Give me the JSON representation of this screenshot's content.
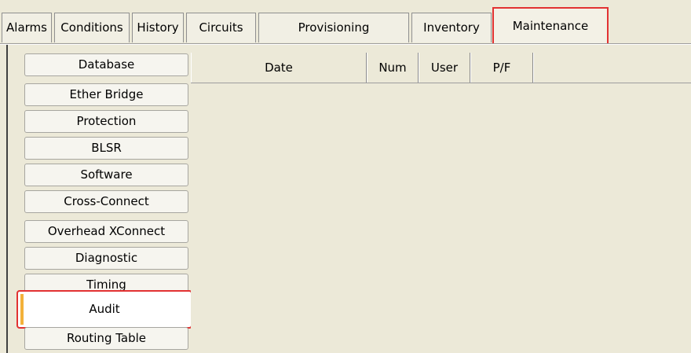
{
  "tabs": [
    {
      "label": "Alarms"
    },
    {
      "label": "Conditions"
    },
    {
      "label": "History"
    },
    {
      "label": "Circuits"
    },
    {
      "label": "Provisioning"
    },
    {
      "label": "Inventory"
    },
    {
      "label": "Maintenance",
      "active": true
    }
  ],
  "sidebar": {
    "items": [
      {
        "label": "Database"
      },
      {
        "label": "Ether Bridge"
      },
      {
        "label": "Protection"
      },
      {
        "label": "BLSR"
      },
      {
        "label": "Software"
      },
      {
        "label": "Cross-Connect"
      },
      {
        "label": "Overhead XConnect"
      },
      {
        "label": "Diagnostic"
      },
      {
        "label": "Timing"
      },
      {
        "label": "Audit",
        "selected": true
      },
      {
        "label": "Routing Table"
      }
    ]
  },
  "table": {
    "columns": [
      {
        "label": "Date"
      },
      {
        "label": "Num"
      },
      {
        "label": "User"
      },
      {
        "label": "P/F"
      }
    ],
    "rows": []
  },
  "colors": {
    "highlight": "#e23232",
    "accent": "#f3b13a",
    "background": "#ece9d8"
  }
}
